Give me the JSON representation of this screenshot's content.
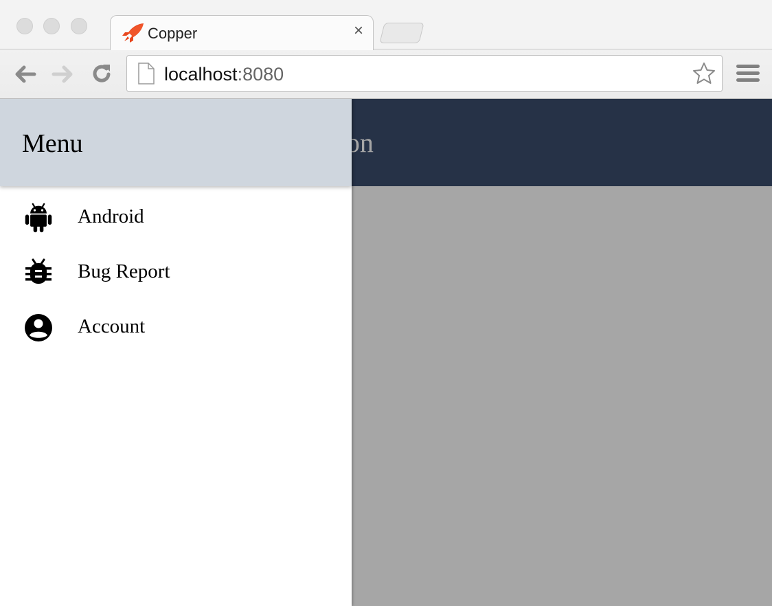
{
  "browser": {
    "tab_title": "Copper",
    "tab_close": "×",
    "url_host": "localhost",
    "url_port": ":8080",
    "accent_favicon_color": "#e8461d",
    "icons": [
      "back-arrow-icon",
      "forward-arrow-icon",
      "reload-icon",
      "page-icon",
      "star-icon",
      "hamburger-menu-icon"
    ]
  },
  "app": {
    "appbar_title": "Application",
    "appbar_color": "#3b4e6e"
  },
  "drawer": {
    "title": "Menu",
    "header_color": "#cfd6de",
    "items": [
      {
        "label": "Android",
        "icon": "android-icon"
      },
      {
        "label": "Bug Report",
        "icon": "bug-icon"
      },
      {
        "label": "Account",
        "icon": "account-circle-icon"
      }
    ]
  }
}
